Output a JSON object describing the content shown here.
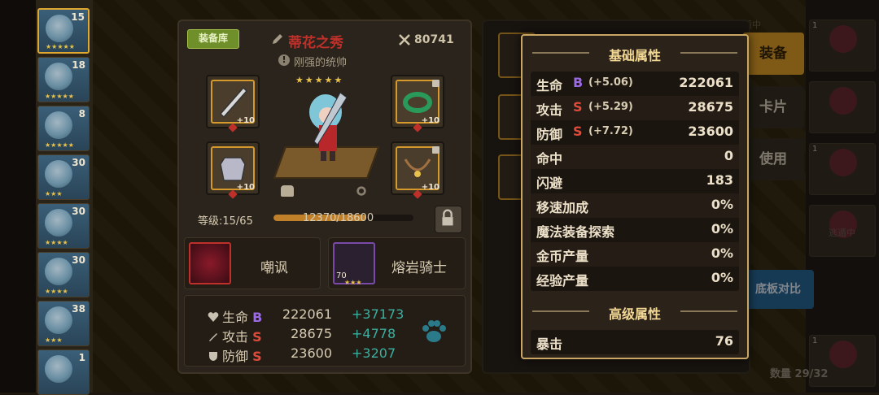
{
  "hero_list": [
    {
      "level": "15",
      "stars": "★★★★★"
    },
    {
      "level": "18",
      "stars": "★★★★★"
    },
    {
      "level": "8",
      "stars": "★★★★★"
    },
    {
      "level": "30",
      "stars": "★★★"
    },
    {
      "level": "30",
      "stars": "★★★★"
    },
    {
      "level": "30",
      "stars": "★★★★"
    },
    {
      "level": "38",
      "stars": "★★★"
    },
    {
      "level": "1",
      "stars": ""
    }
  ],
  "equip_panel": {
    "armory_label": "装备库",
    "hero_name": "蒂花之秀",
    "power": "80741",
    "hero_title": "刚强的统帅",
    "hero_stars": "★★★★★",
    "slots": [
      {
        "plus": "+10",
        "icon": "sword-icon"
      },
      {
        "plus": "+10",
        "icon": "ring-icon"
      },
      {
        "plus": "+10",
        "icon": "armor-icon"
      },
      {
        "plus": "+10",
        "icon": "necklace-icon"
      }
    ],
    "level_text": "等级:15/65",
    "xp_text": "12370/18600",
    "xp_fraction": 0.665,
    "skill_name": "嘲讽",
    "card_name": "熔岩骑士",
    "card_level": "70",
    "card_stars": "★★★",
    "stats": [
      {
        "label": "生命",
        "grade": "B",
        "value": "222061",
        "bonus": "+37173"
      },
      {
        "label": "攻击",
        "grade": "S",
        "value": "28675",
        "bonus": "+4778"
      },
      {
        "label": "防御",
        "grade": "S",
        "value": "23600",
        "bonus": "+3207"
      }
    ]
  },
  "right_buttons": {
    "equip": "装备",
    "card": "卡片",
    "use": "使用",
    "compare": "底板对比"
  },
  "right_tiles": [
    {
      "num": "1"
    },
    {
      "num": ""
    },
    {
      "num": "1"
    },
    {
      "num": ""
    },
    {
      "num": "1"
    }
  ],
  "ghost_labels": [
    "逃遁中",
    "逃遁中"
  ],
  "bottom_count": "数量 29/32",
  "popup": {
    "basic_title": "基础属性",
    "advanced_title": "高级属性",
    "basic": [
      {
        "label": "生命",
        "grade": "B",
        "bonus": "(+5.06)",
        "value": "222061"
      },
      {
        "label": "攻击",
        "grade": "S",
        "bonus": "(+5.29)",
        "value": "28675"
      },
      {
        "label": "防御",
        "grade": "S",
        "bonus": "(+7.72)",
        "value": "23600"
      },
      {
        "label": "命中",
        "grade": "",
        "bonus": "",
        "value": "0"
      },
      {
        "label": "闪避",
        "grade": "",
        "bonus": "",
        "value": "183"
      },
      {
        "label": "移速加成",
        "grade": "",
        "bonus": "",
        "value": "0%"
      },
      {
        "label": "魔法装备探索",
        "grade": "",
        "bonus": "",
        "value": "0%"
      },
      {
        "label": "金币产量",
        "grade": "",
        "bonus": "",
        "value": "0%"
      },
      {
        "label": "经验产量",
        "grade": "",
        "bonus": "",
        "value": "0%"
      }
    ],
    "advanced": [
      {
        "label": "暴击",
        "value": "76"
      }
    ]
  },
  "colors": {
    "grade_b": "#9a6ae0",
    "grade_s": "#e04a3a",
    "popup_border": "#c9a664",
    "title_gold": "#f3d894",
    "equip_button": "#e8a428"
  }
}
